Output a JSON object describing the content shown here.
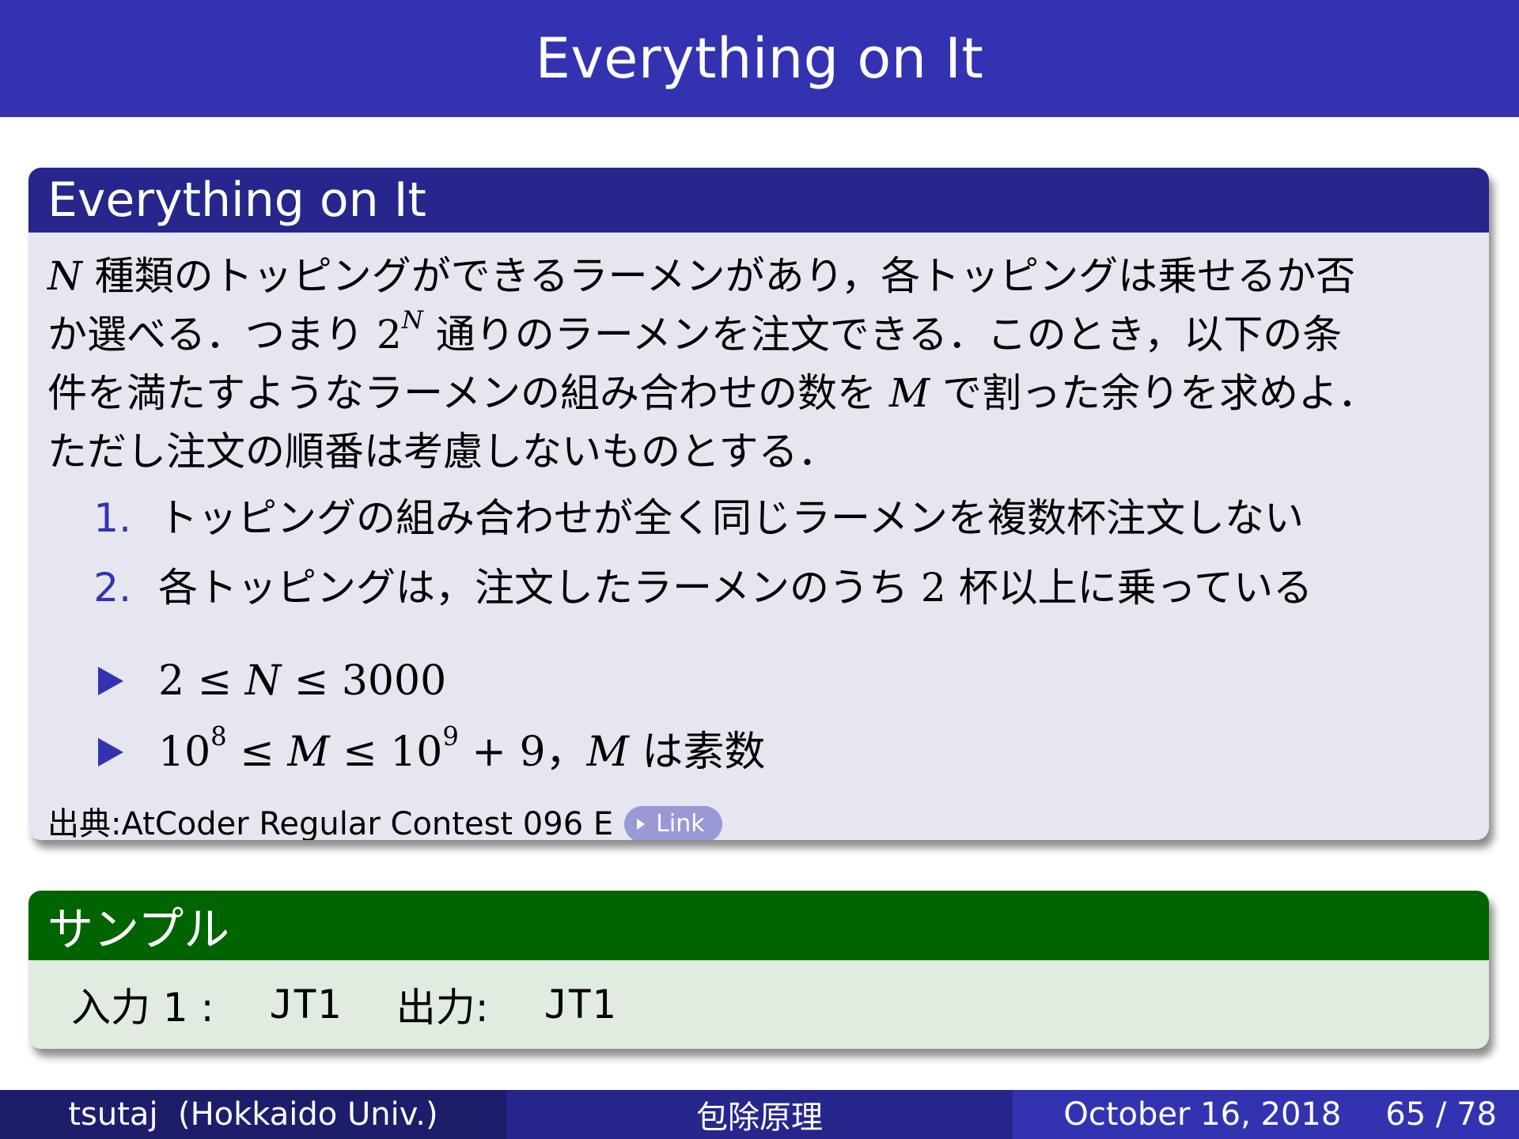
{
  "frame_title": "Everything on It",
  "problem": {
    "title": "Everything on It",
    "lines": [
      [
        "N",
        " 種類のトッピングができるラーメンがあり，各トッピングは乗せるか否"
      ],
      [
        "か選べる．つまり ",
        "2",
        "N",
        " 通りのラーメンを注文できる．このとき，以下の条"
      ],
      [
        "件を満たすようなラーメンの組み合わせの数を ",
        "M",
        " で割った余りを求めよ．"
      ],
      [
        "ただし注文の順番は考慮しないものとする．"
      ]
    ],
    "conditions": [
      {
        "num": "1.",
        "text": "トッピングの組み合わせが全く同じラーメンを複数杯注文しない"
      },
      {
        "num": "2.",
        "text_a": "各トッピングは，注文したラーメンのうち ",
        "n": "2",
        "text_b": " 杯以上に乗っている"
      }
    ],
    "constraints": {
      "c1": {
        "a": "2 ≤ ",
        "v": "N",
        "b": " ≤ 3000"
      },
      "c2": {
        "base1": "10",
        "exp1": "8",
        "mid": " ≤ ",
        "v": "M",
        "mid2": " ≤ 10",
        "exp2": "9",
        "tail": " + 9，",
        "v2": "M",
        "jp": " は素数"
      }
    },
    "source_prefix": "出典: ",
    "source": "AtCoder Regular Contest 096 E",
    "link_label": "Link"
  },
  "sample": {
    "title": "サンプル",
    "input_label": "入力 1 :",
    "input_value": "JT1",
    "output_label": "出力:",
    "output_value": "JT1"
  },
  "footer": {
    "author": "tsutaj  (Hokkaido Univ.)",
    "topic": "包除原理",
    "date": "October 16, 2018",
    "page": "65 / 78"
  },
  "colors": {
    "title_bar": "#3333b2",
    "block_header": "#26268c",
    "block_body": "#e6e6f1",
    "sample_header": "#006400",
    "sample_body": "#e1ece1",
    "footer_left": "#1d1d6c",
    "footer_mid": "#26268c",
    "footer_right": "#3333b2"
  },
  "icons": [
    "triangle-bullet-icon",
    "link-triangle-icon"
  ]
}
